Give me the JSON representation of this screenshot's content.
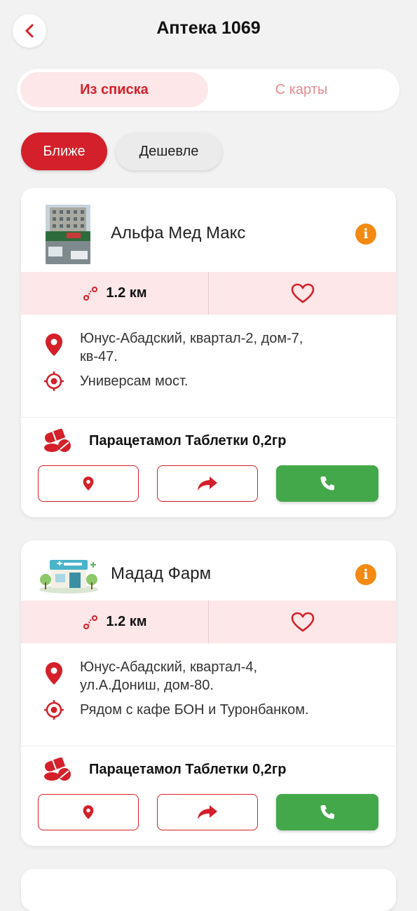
{
  "header": {
    "title": "Аптека 1069",
    "back_icon": "chevron-left-icon"
  },
  "segments": [
    {
      "label": "Из списка",
      "active": true
    },
    {
      "label": "С карты",
      "active": false
    }
  ],
  "sort": {
    "near_label": "Ближе",
    "cheap_label": "Дешевле",
    "selected": "Ближе"
  },
  "colors": {
    "accent": "#d3202a",
    "tint": "#fde7e8",
    "call": "#43a84a",
    "info": "#f28a13"
  },
  "pharmacies": [
    {
      "name": "Альфа Мед Макс",
      "distance": "1.2 км",
      "address_line1": "Юнус-Абадский, квартал-2,  дом-7,",
      "address_line2": "кв-47.",
      "landmark": "Универсам мост.",
      "drug": "Парацетамол Таблетки 0,2гр",
      "image": "storefront-photo"
    },
    {
      "name": "Мадад Фарм",
      "distance": "1.2 км",
      "address_line1": "Юнус-Абадский,  квартал-4,",
      "address_line2": "ул.А.Дониш, дом-80.",
      "landmark": "Рядом с кафе БОН и Туронбанком.",
      "drug": "Парацетамол Таблетки 0,2гр",
      "image": "pharmacy-illustration"
    }
  ]
}
